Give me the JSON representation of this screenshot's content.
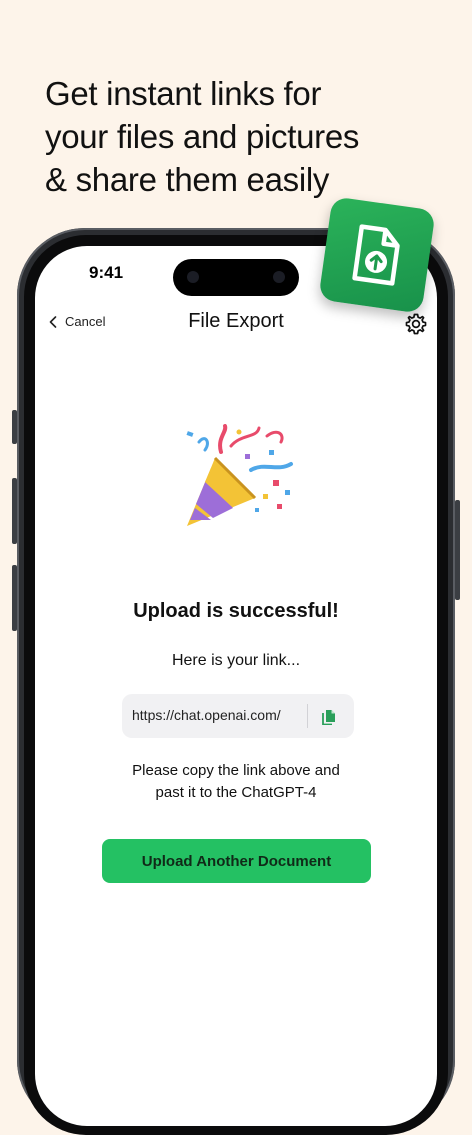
{
  "headline": {
    "line1": "Get instant links for",
    "line2": "your files and pictures",
    "line3": "& share them easily"
  },
  "status": {
    "time": "9:41"
  },
  "nav": {
    "cancel_label": "Cancel",
    "title": "File Export",
    "icons": {
      "back": "chevron-left-icon",
      "settings": "gear-icon"
    }
  },
  "main": {
    "illustration": "party-popper-icon",
    "success_title": "Upload is successful!",
    "link_intro": "Here is your link...",
    "link_value": "https://chat.openai.com/",
    "copy_icon": "copy-icon",
    "instruction_line1": "Please copy the link above and",
    "instruction_line2": "past it to the ChatGPT-4",
    "upload_button_label": "Upload Another Document"
  },
  "badge": {
    "icon": "file-upload-icon",
    "color": "#22a855"
  },
  "colors": {
    "accent": "#24c163",
    "background": "#fdf4ea"
  }
}
